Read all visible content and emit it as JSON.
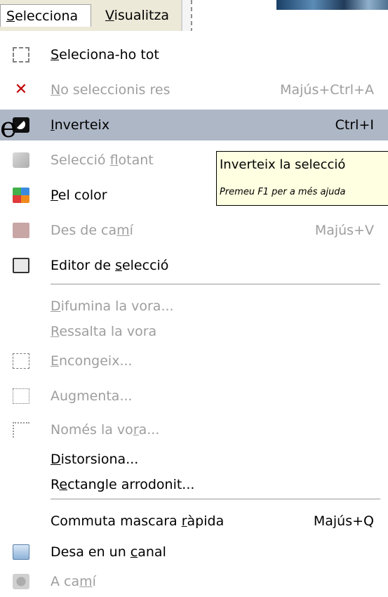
{
  "menubar": {
    "items": [
      {
        "label_u": "S",
        "label_rest": "elecciona",
        "active": true
      },
      {
        "label_u": "V",
        "label_rest": "isualitza",
        "active": false
      }
    ]
  },
  "edge_glyph": "e",
  "menu": {
    "items": [
      {
        "u_pre": "",
        "u": "S",
        "post": "eleciona-ho tot",
        "shortcut": "",
        "icon": "select-all-icon",
        "disabled": false
      },
      {
        "u_pre": "",
        "u": "N",
        "post": "o seleccionis res",
        "shortcut": "Majús+Ctrl+A",
        "icon": "select-none-icon",
        "disabled": true
      },
      {
        "u_pre": "",
        "u": "I",
        "post": "nverteix",
        "shortcut": "Ctrl+I",
        "icon": "invert-icon",
        "disabled": false,
        "highlighted": true
      },
      {
        "u_pre": "Selecció ",
        "u": "f",
        "post": "lotant",
        "shortcut": "",
        "icon": "float-icon",
        "disabled": true
      },
      {
        "u_pre": "",
        "u": "P",
        "post": "el color",
        "shortcut": "",
        "icon": "by-color-icon",
        "disabled": false
      },
      {
        "u_pre": "Des de ca",
        "u": "m",
        "post": "í",
        "shortcut": "Majús+V",
        "icon": "from-path-icon",
        "disabled": true
      },
      {
        "u_pre": "Editor de ",
        "u": "s",
        "post": "elecció",
        "shortcut": "",
        "icon": "selection-editor-icon",
        "disabled": false
      },
      {
        "u_pre": "",
        "u": "D",
        "post": "ifumina la vora...",
        "shortcut": "",
        "icon": "",
        "disabled": true
      },
      {
        "u_pre": "",
        "u": "R",
        "post": "essalta la vora",
        "shortcut": "",
        "icon": "",
        "disabled": true
      },
      {
        "u_pre": "",
        "u": "E",
        "post": "ncongeix...",
        "shortcut": "",
        "icon": "shrink-icon",
        "disabled": true
      },
      {
        "u_pre": "Au",
        "u": "g",
        "post": "menta...",
        "shortcut": "",
        "icon": "grow-icon",
        "disabled": true
      },
      {
        "u_pre": "Només la vo",
        "u": "r",
        "post": "a...",
        "shortcut": "",
        "icon": "border-icon",
        "disabled": true
      },
      {
        "u_pre": "",
        "u": "D",
        "post": "istorsiona...",
        "shortcut": "",
        "icon": "",
        "disabled": false
      },
      {
        "u_pre": "R",
        "u": "e",
        "post": "ctangle arrodonit...",
        "shortcut": "",
        "icon": "",
        "disabled": false
      },
      {
        "u_pre": "Commuta mascara ",
        "u": "r",
        "post": "àpida",
        "shortcut": "Majús+Q",
        "icon": "",
        "disabled": false
      },
      {
        "u_pre": "Desa en un ",
        "u": "c",
        "post": "anal",
        "shortcut": "",
        "icon": "save-to-channel-icon",
        "disabled": false
      },
      {
        "u_pre": "A ca",
        "u": "m",
        "post": "í",
        "shortcut": "",
        "icon": "to-path-icon",
        "disabled": true
      }
    ]
  },
  "tooltip": {
    "title": "Inverteix la selecció",
    "help": "Premeu F1 per a més ajuda"
  }
}
